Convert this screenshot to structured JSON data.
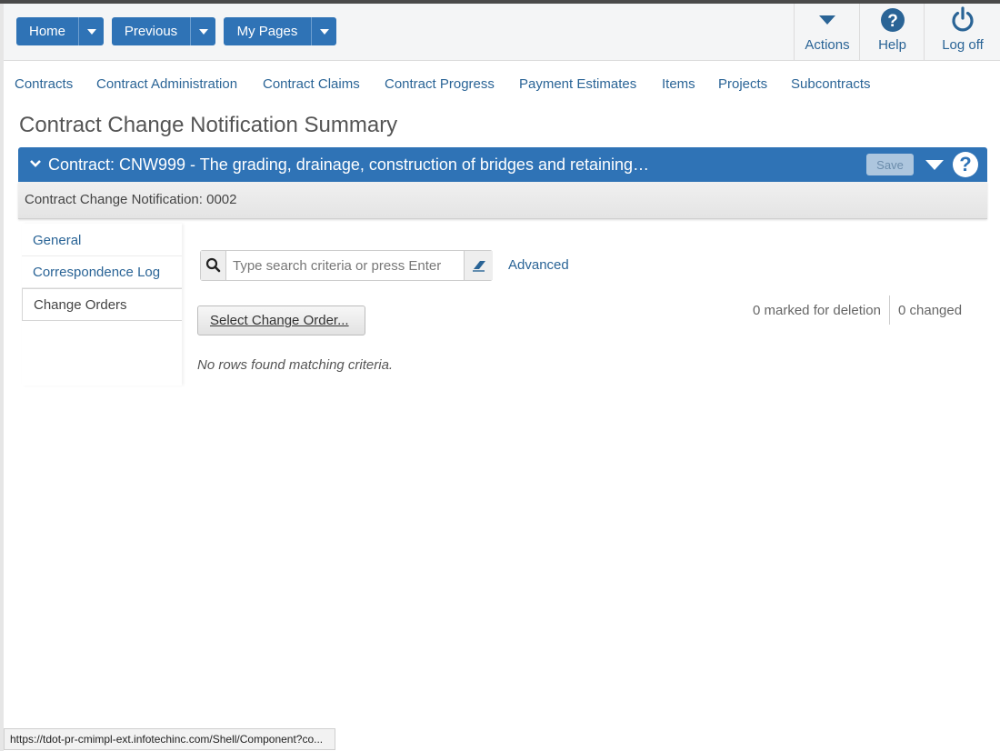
{
  "header": {
    "home": "Home",
    "previous": "Previous",
    "my_pages": "My Pages",
    "actions": "Actions",
    "help": "Help",
    "logoff": "Log off"
  },
  "nav": [
    "Contracts",
    "Contract Administration",
    "Contract Claims",
    "Contract Progress",
    "Payment Estimates",
    "Items",
    "Projects",
    "Subcontracts"
  ],
  "page_title": "Contract Change Notification Summary",
  "contract_bar": {
    "title": "Contract: CNW999 - The grading, drainage, construction of bridges and retaining…",
    "save": "Save"
  },
  "sub_header": "Contract Change Notification: 0002",
  "side_nav": [
    "General",
    "Correspondence Log",
    "Change Orders"
  ],
  "search": {
    "placeholder": "Type search criteria or press Enter",
    "advanced": "Advanced"
  },
  "select_button": "Select Change Order...",
  "marked_for_deletion": "0 marked for deletion",
  "changed": "0 changed",
  "no_rows": "No rows found matching criteria.",
  "status_url": "https://tdot-pr-cmimpl-ext.infotechinc.com/Shell/Component?co...",
  "colors": {
    "primary": "#2f73b6",
    "link": "#2a6496"
  }
}
